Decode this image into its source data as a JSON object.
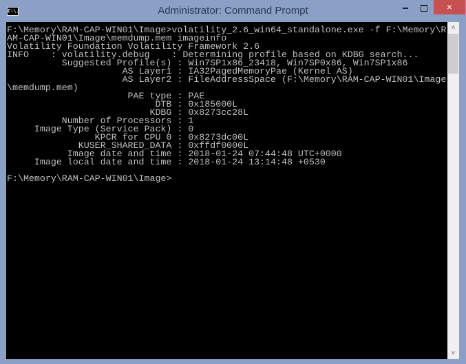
{
  "window": {
    "title": "Administrator: Command Prompt",
    "icon": "cmd-icon",
    "icon_text": "C:\\.",
    "controls": {
      "minimize": "minimize-icon",
      "maximize": "maximize-icon",
      "close": "×"
    }
  },
  "console": {
    "lines": [
      "F:\\Memory\\RAM-CAP-WIN01\\Image>volatility_2.6_win64_standalone.exe -f F:\\Memory\\R",
      "AM-CAP-WIN01\\Image\\memdump.mem imageinfo",
      "Volatility Foundation Volatility Framework 2.6",
      "INFO    : volatility.debug    : Determining profile based on KDBG search...",
      "          Suggested Profile(s) : Win7SP1x86_23418, Win7SP0x86, Win7SP1x86",
      "                     AS Layer1 : IA32PagedMemoryPae (Kernel AS)",
      "                     AS Layer2 : FileAddressSpace (F:\\Memory\\RAM-CAP-WIN01\\Image",
      "\\memdump.mem)",
      "                      PAE type : PAE",
      "                           DTB : 0x185000L",
      "                          KDBG : 0x8273cc28L",
      "          Number of Processors : 1",
      "     Image Type (Service Pack) : 0",
      "                KPCR for CPU 0 : 0x8273dc00L",
      "             KUSER_SHARED_DATA : 0xffdf0000L",
      "           Image date and time : 2018-01-24 07:44:48 UTC+0000",
      "     Image local date and time : 2018-01-24 13:14:48 +0530",
      "",
      "F:\\Memory\\RAM-CAP-WIN01\\Image>"
    ]
  },
  "scrollbar": {
    "up": "˄",
    "down": "˅"
  },
  "colors": {
    "frame": "#8aa0c7",
    "console_bg": "#000000",
    "console_text": "#c0c0c0",
    "close": "#c75050"
  }
}
